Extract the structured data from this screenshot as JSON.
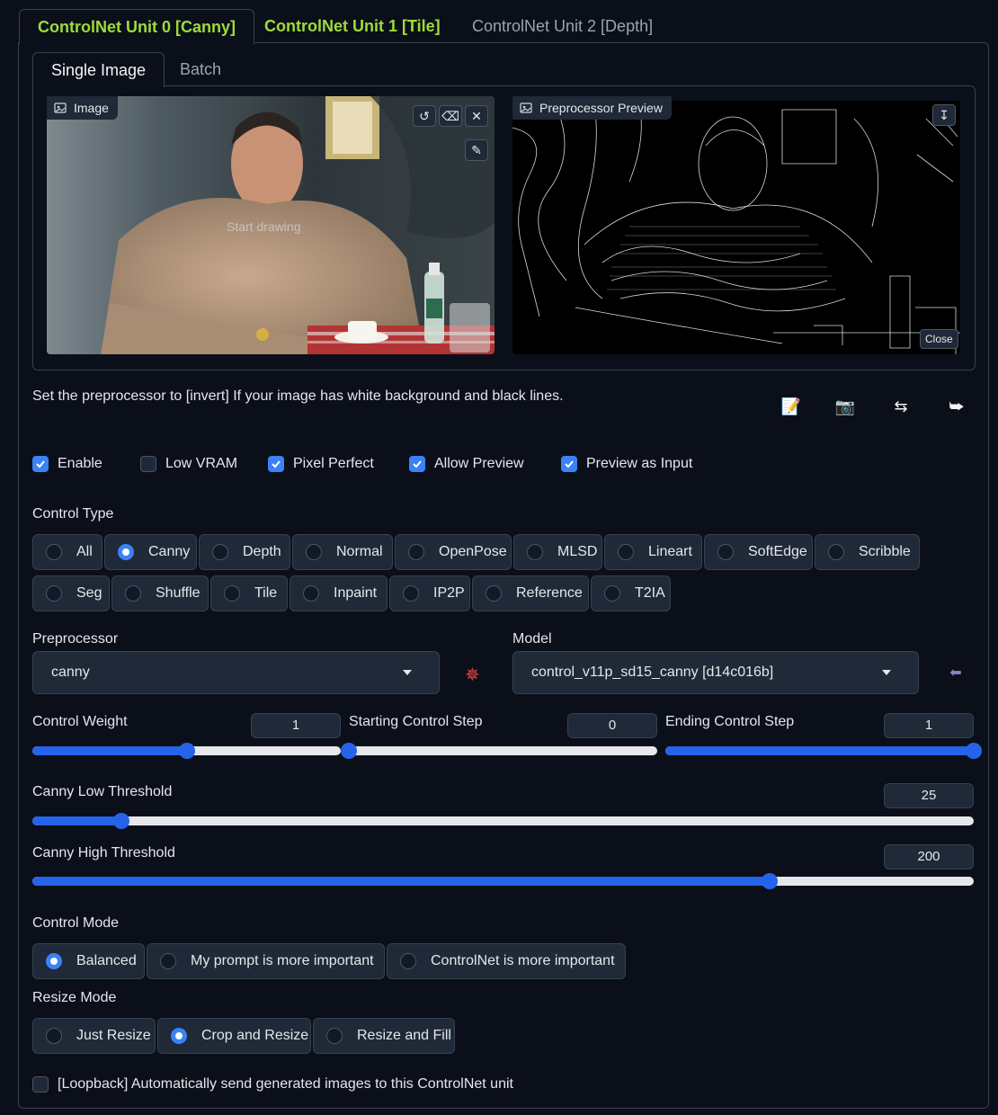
{
  "unit_tabs": [
    "ControlNet Unit 0 [Canny]",
    "ControlNet Unit 1 [Tile]",
    "ControlNet Unit 2 [Depth]"
  ],
  "sub_tabs": [
    "Single Image",
    "Batch"
  ],
  "image_input": {
    "label": "Image",
    "canvas_hint": "Start drawing"
  },
  "preview": {
    "label": "Preprocessor Preview",
    "close_label": "Close"
  },
  "hint": "Set the preprocessor to [invert] If your image has white background and black lines.",
  "options": [
    {
      "label": "Enable",
      "checked": true
    },
    {
      "label": "Low VRAM",
      "checked": false
    },
    {
      "label": "Pixel Perfect",
      "checked": true
    },
    {
      "label": "Allow Preview",
      "checked": true
    },
    {
      "label": "Preview as Input",
      "checked": true
    }
  ],
  "control_type": {
    "label": "Control Type",
    "selected": "Canny",
    "options": [
      "All",
      "Canny",
      "Depth",
      "Normal",
      "OpenPose",
      "MLSD",
      "Lineart",
      "SoftEdge",
      "Scribble",
      "Seg",
      "Shuffle",
      "Tile",
      "Inpaint",
      "IP2P",
      "Reference",
      "T2IA"
    ]
  },
  "preprocessor": {
    "label": "Preprocessor",
    "value": "canny"
  },
  "model": {
    "label": "Model",
    "value": "control_v11p_sd15_canny [d14c016b]"
  },
  "sliders": {
    "control_weight": {
      "label": "Control Weight",
      "value": "1",
      "min": 0,
      "max": 2,
      "num": 1
    },
    "starting_step": {
      "label": "Starting Control Step",
      "value": "0",
      "min": 0,
      "max": 1,
      "num": 0
    },
    "ending_step": {
      "label": "Ending Control Step",
      "value": "1",
      "min": 0,
      "max": 1,
      "num": 1
    },
    "canny_low": {
      "label": "Canny Low Threshold",
      "value": "25",
      "min": 1,
      "max": 255,
      "num": 25
    },
    "canny_high": {
      "label": "Canny High Threshold",
      "value": "200",
      "min": 1,
      "max": 255,
      "num": 200
    }
  },
  "control_mode": {
    "label": "Control Mode",
    "selected": "Balanced",
    "options": [
      "Balanced",
      "My prompt is more important",
      "ControlNet is more important"
    ]
  },
  "resize_mode": {
    "label": "Resize Mode",
    "selected": "Crop and Resize",
    "options": [
      "Just Resize",
      "Crop and Resize",
      "Resize and Fill"
    ]
  },
  "loopback": {
    "label": "[Loopback] Automatically send generated images to this ControlNet unit",
    "checked": false
  },
  "colors": {
    "accent": "#2563eb",
    "tab_green": "#9ddc3a",
    "background": "#0b0f19",
    "panel": "#1f2937"
  }
}
